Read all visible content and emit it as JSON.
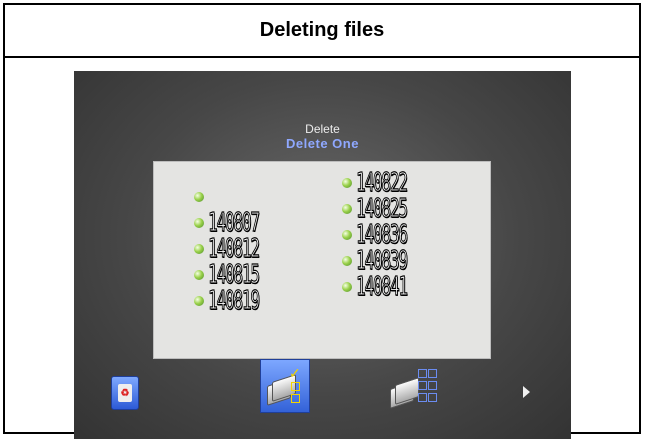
{
  "header": {
    "title": "Deleting files"
  },
  "screen": {
    "mode_title": "Delete",
    "mode_subtitle": "Delete One",
    "files_left": [
      "",
      "140807",
      "140812",
      "140815",
      "140819"
    ],
    "files_right": [
      "140822",
      "140825",
      "140836",
      "140839",
      "140841"
    ]
  },
  "toolbar": {
    "icons": [
      "trash-icon",
      "delete-one-icon",
      "delete-selected-icon",
      "next-arrow-icon"
    ]
  },
  "colors": {
    "subtitle": "#8fa8ff",
    "selected_tool": "#3362d8",
    "file_dot": "#9ad14a"
  }
}
